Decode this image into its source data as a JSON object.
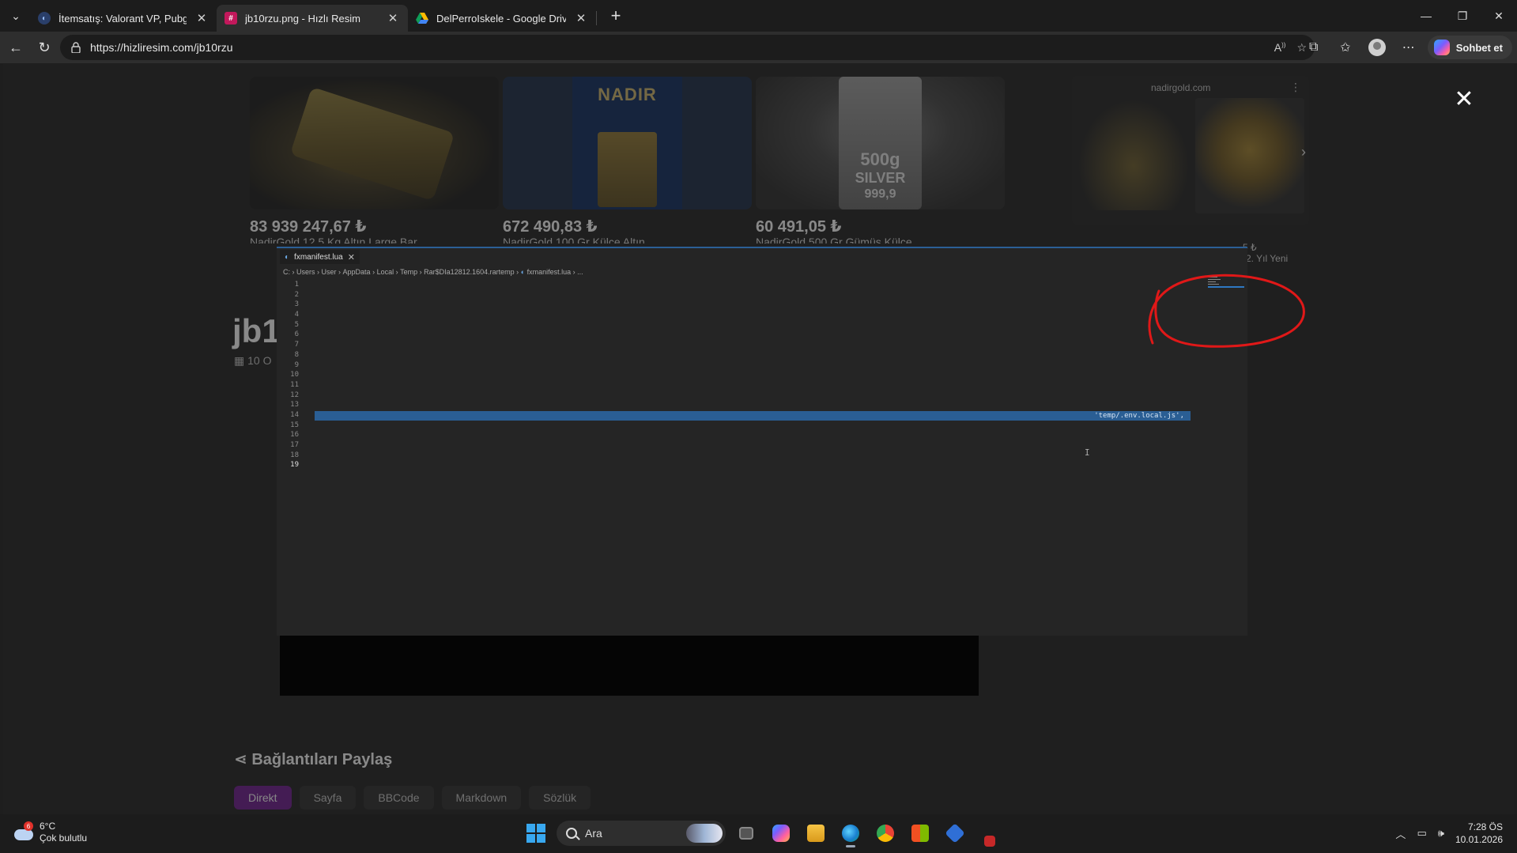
{
  "browser": {
    "tabs": [
      {
        "title": "İtemsatış: Valorant VP, Pubg Mobile",
        "favicon": "itemsatis-icon",
        "active": false
      },
      {
        "title": "jb10rzu.png - Hızlı Resim",
        "favicon": "hizliresim-icon",
        "active": true
      },
      {
        "title": "DelPerroIskele - Google Drive",
        "favicon": "google-drive-icon",
        "active": false
      }
    ],
    "url": "https://hizliresim.com/jb10rzu",
    "copilot_label": "Sohbet et"
  },
  "page": {
    "products": [
      {
        "price": "83 939 247,67 ₺",
        "name": "NadirGold 12,5 Kg Altın Large Bar"
      },
      {
        "price": "672 490,83 ₺",
        "name": "NadirGold 100 Gr Külçe Altın",
        "brand": "NADIR"
      },
      {
        "price": "60 491,05 ₺",
        "name": "NadirGold 500 Gr Gümüş Külçe",
        "engraving_weight": "500g",
        "engraving_metal": "SILVER",
        "engraving_purity": "999,9"
      }
    ],
    "ad": {
      "domain": "nadirgold.com",
      "price_fragment": "5 ₺",
      "sub_fragment": "(2. Yıl Yeni"
    },
    "title_fragment": "jb1",
    "date_fragment": "10 O",
    "share": {
      "title": "Bağlantıları Paylaş",
      "tabs": [
        "Direkt",
        "Sayfa",
        "BBCode",
        "Markdown",
        "Sözlük"
      ]
    }
  },
  "lightbox": {
    "close_symbol": "✕",
    "editor": {
      "tab_name": "fxmanifest.lua",
      "breadcrumb": [
        "C:",
        "Users",
        "User",
        "AppData",
        "Local",
        "Temp",
        "Rar$DIa12812.1604.rartemp",
        "fxmanifest.lua",
        "..."
      ],
      "line_numbers": [
        "1",
        "2",
        "3",
        "4",
        "5",
        "6",
        "7",
        "8",
        "9",
        "10",
        "11",
        "12",
        "13",
        "14",
        "15",
        "16",
        "17",
        "18",
        "19"
      ],
      "current_line": "19",
      "selected_line": "17",
      "selected_text": "'temp/.env.local.js',"
    }
  },
  "taskbar": {
    "weather_temp": "6°C",
    "weather_desc": "Çok bulutlu",
    "weather_badge": "6",
    "search_placeholder": "Ara",
    "time": "7:28 ÖS",
    "date": "10.01.2026"
  },
  "colors": {
    "accent": "#2a5e94",
    "annotation_red": "#e01818",
    "active_share_tab": "#6a1a8a"
  }
}
